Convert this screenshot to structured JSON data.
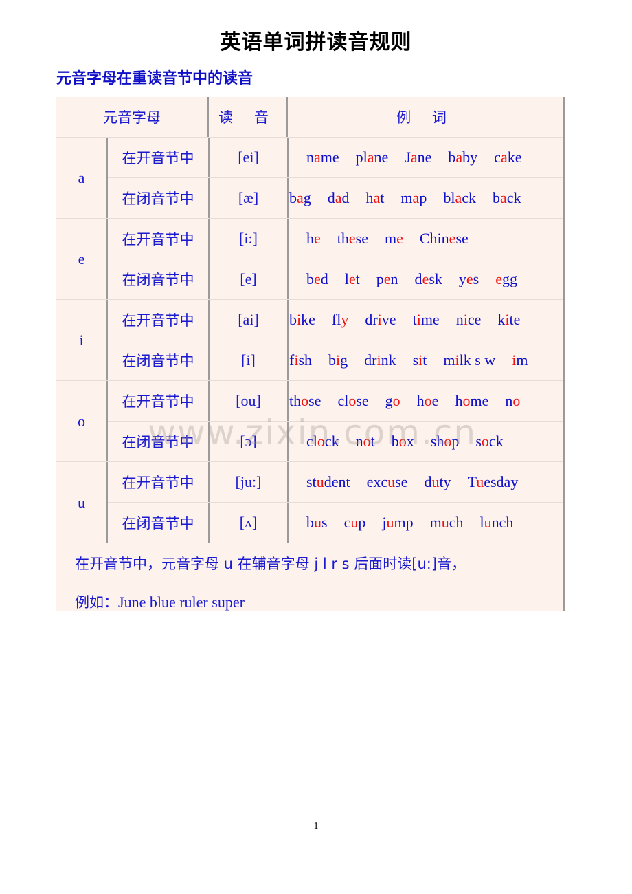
{
  "title": "英语单词拼读音规则",
  "subtitle": "元音字母在重读音节中的读音",
  "table": {
    "headers": {
      "letter": "元音字母",
      "pronunciation": "读 音",
      "examples": "例 词"
    },
    "groups": [
      {
        "letter": "a",
        "rows": [
          {
            "syllable": "在开音节中",
            "pron": "[ei]",
            "indent": true,
            "words": [
              {
                "pre": "n",
                "hl": "a",
                "post": "me"
              },
              {
                "pre": "pl",
                "hl": "a",
                "post": "ne"
              },
              {
                "pre": "J",
                "hl": "a",
                "post": "ne"
              },
              {
                "pre": "b",
                "hl": "a",
                "post": "by"
              },
              {
                "pre": "c",
                "hl": "a",
                "post": "ke"
              }
            ]
          },
          {
            "syllable": "在闭音节中",
            "pron": "[æ]",
            "indent": false,
            "words": [
              {
                "pre": "b",
                "hl": "a",
                "post": "g"
              },
              {
                "pre": "d",
                "hl": "a",
                "post": "d"
              },
              {
                "pre": "h",
                "hl": "a",
                "post": "t"
              },
              {
                "pre": "m",
                "hl": "a",
                "post": "p"
              },
              {
                "pre": "bl",
                "hl": "a",
                "post": "ck"
              },
              {
                "pre": "b",
                "hl": "a",
                "post": "ck"
              }
            ]
          }
        ]
      },
      {
        "letter": "e",
        "rows": [
          {
            "syllable": "在开音节中",
            "pron": "[i:]",
            "indent": true,
            "words": [
              {
                "pre": "h",
                "hl": "e",
                "post": ""
              },
              {
                "pre": "th",
                "hl": "e",
                "post": "se"
              },
              {
                "pre": "m",
                "hl": "e",
                "post": ""
              },
              {
                "pre": "Chin",
                "hl": "e",
                "post": "se"
              }
            ]
          },
          {
            "syllable": "在闭音节中",
            "pron": "[e]",
            "indent": true,
            "words": [
              {
                "pre": "b",
                "hl": "e",
                "post": "d"
              },
              {
                "pre": "l",
                "hl": "e",
                "post": "t"
              },
              {
                "pre": "p",
                "hl": "e",
                "post": "n"
              },
              {
                "pre": "d",
                "hl": "e",
                "post": "sk"
              },
              {
                "pre": "y",
                "hl": "e",
                "post": "s"
              },
              {
                "pre": "",
                "hl": "e",
                "post": "gg"
              }
            ]
          }
        ]
      },
      {
        "letter": "i",
        "rows": [
          {
            "syllable": "在开音节中",
            "pron": "[ai]",
            "indent": false,
            "words": [
              {
                "pre": "b",
                "hl": "i",
                "post": "ke"
              },
              {
                "pre": "fl",
                "hl": "y",
                "post": ""
              },
              {
                "pre": "dr",
                "hl": "i",
                "post": "ve"
              },
              {
                "pre": "t",
                "hl": "i",
                "post": "me"
              },
              {
                "pre": "n",
                "hl": "i",
                "post": "ce"
              },
              {
                "pre": "k",
                "hl": "i",
                "post": "te"
              }
            ]
          },
          {
            "syllable": "在闭音节中",
            "pron": "[i]",
            "indent": false,
            "words": [
              {
                "pre": "f",
                "hl": "i",
                "post": "sh"
              },
              {
                "pre": "b",
                "hl": "i",
                "post": "g"
              },
              {
                "pre": "dr",
                "hl": "i",
                "post": "nk"
              },
              {
                "pre": "s",
                "hl": "i",
                "post": "t"
              },
              {
                "pre": "m",
                "hl": "i",
                "post": "lk s w"
              },
              {
                "pre": "",
                "hl": "i",
                "post": "m"
              }
            ]
          }
        ]
      },
      {
        "letter": "o",
        "rows": [
          {
            "syllable": "在开音节中",
            "pron": "[ou]",
            "indent": false,
            "words": [
              {
                "pre": "th",
                "hl": "o",
                "post": "se"
              },
              {
                "pre": "cl",
                "hl": "o",
                "post": "se"
              },
              {
                "pre": "g",
                "hl": "o",
                "post": ""
              },
              {
                "pre": "h",
                "hl": "o",
                "post": "e"
              },
              {
                "pre": "h",
                "hl": "o",
                "post": "me"
              },
              {
                "pre": "n",
                "hl": "o",
                "post": ""
              }
            ]
          },
          {
            "syllable": "在闭音节中",
            "pron": "[ɔ]",
            "indent": true,
            "words": [
              {
                "pre": "cl",
                "hl": "o",
                "post": "ck"
              },
              {
                "pre": "n",
                "hl": "o",
                "post": "t"
              },
              {
                "pre": "b",
                "hl": "o",
                "post": "x"
              },
              {
                "pre": "sh",
                "hl": "o",
                "post": "p"
              },
              {
                "pre": "s",
                "hl": "o",
                "post": "ck"
              }
            ]
          }
        ]
      },
      {
        "letter": "u",
        "rows": [
          {
            "syllable": "在开音节中",
            "pron": "[ju:]",
            "indent": true,
            "words": [
              {
                "pre": "st",
                "hl": "u",
                "post": "dent"
              },
              {
                "pre": "exc",
                "hl": "u",
                "post": "se"
              },
              {
                "pre": "d",
                "hl": "u",
                "post": "ty"
              },
              {
                "pre": "T",
                "hl": "u",
                "post": "esday"
              }
            ]
          },
          {
            "syllable": "在闭音节中",
            "pron": "[ʌ]",
            "indent": true,
            "words": [
              {
                "pre": "b",
                "hl": "u",
                "post": "s"
              },
              {
                "pre": "c",
                "hl": "u",
                "post": "p"
              },
              {
                "pre": "j",
                "hl": "u",
                "post": "mp"
              },
              {
                "pre": "m",
                "hl": "u",
                "post": "ch"
              },
              {
                "pre": "l",
                "hl": "u",
                "post": "nch"
              }
            ]
          }
        ]
      }
    ],
    "note": {
      "line1": "在开音节中，元音字母 u 在辅音字母 j l r s 后面时读[u:]音，",
      "line2_prefix": "例如：",
      "line2_words": [
        {
          "pre": "J",
          "hl": "u",
          "post": "ne"
        },
        {
          "pre": "bl",
          "hl": "u",
          "post": "e"
        },
        {
          "pre": "r",
          "hl": "u",
          "post": "ler"
        },
        {
          "pre": "s",
          "hl": "u",
          "post": "per"
        }
      ]
    }
  },
  "watermark": "www.zixin.com.cn",
  "page_number": "1",
  "colors": {
    "text_blue": "#1010c8",
    "highlight_red": "#f01010",
    "table_bg": "#fdf3ec",
    "border_gray": "#9a9a9a"
  }
}
